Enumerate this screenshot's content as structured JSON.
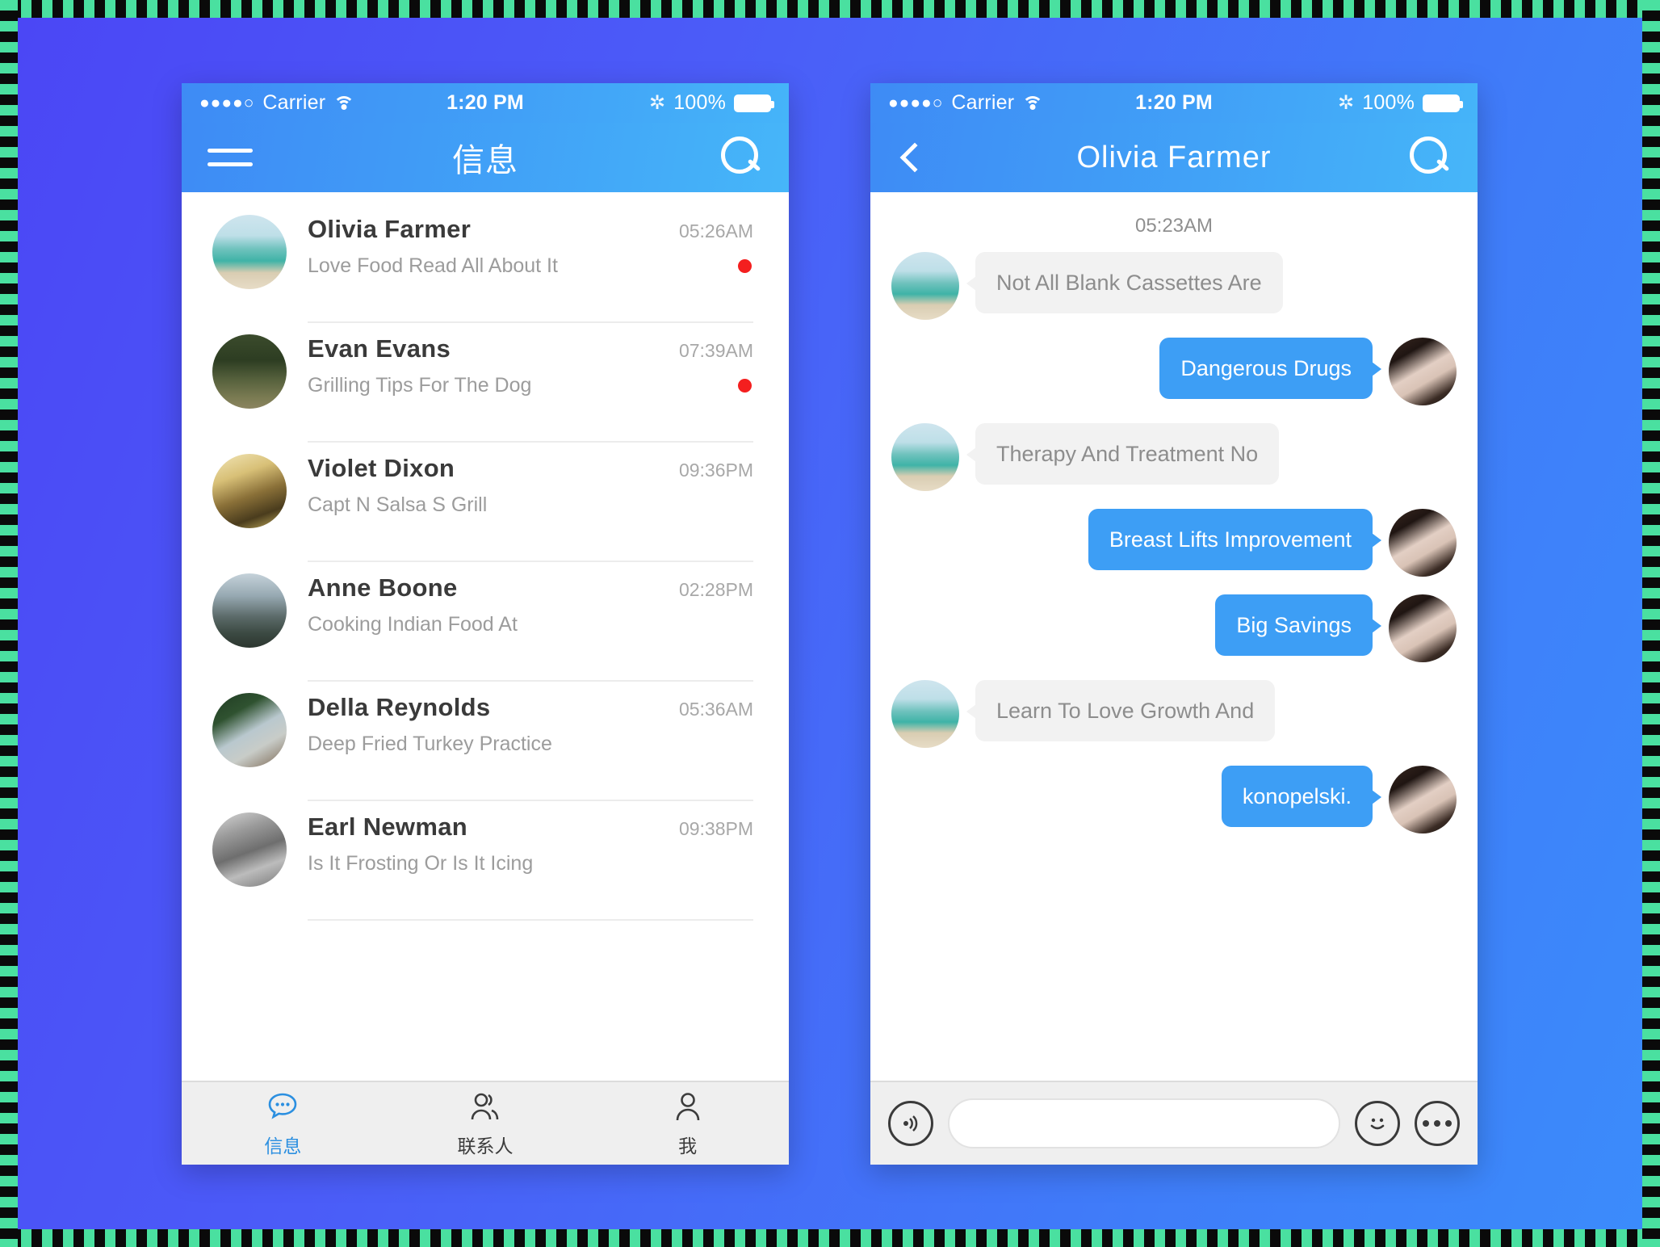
{
  "status_bar": {
    "signal_dots": "●●●●○",
    "carrier": "Carrier",
    "wifi_icon": "wifi-icon",
    "time": "1:20 PM",
    "bluetooth_icon": "bluetooth-icon",
    "bluetooth_glyph": "✲",
    "battery_percent": "100%",
    "battery_icon": "battery-icon"
  },
  "colors": {
    "nav_gradient_start": "#3e8bf5",
    "nav_gradient_end": "#46b6f9",
    "accent_blue": "#3d9ef5",
    "unread_red": "#f41f1f",
    "tab_active": "#2b8fe0",
    "page_background": "#4b4ff6"
  },
  "left_phone": {
    "nav": {
      "menu_icon": "hamburger-menu-icon",
      "title": "信息",
      "search_icon": "search-icon"
    },
    "conversations": [
      {
        "name": "Olivia Farmer",
        "preview": "Love Food Read All About It",
        "time": "05:26AM",
        "unread": true,
        "avatar": "av-beach"
      },
      {
        "name": "Evan Evans",
        "preview": "Grilling Tips For The Dog",
        "time": "07:39AM",
        "unread": true,
        "avatar": "av-forest"
      },
      {
        "name": "Violet Dixon",
        "preview": "Capt N Salsa S Grill",
        "time": "09:36PM",
        "unread": false,
        "avatar": "av-sunset"
      },
      {
        "name": "Anne Boone",
        "preview": "Cooking Indian Food At",
        "time": "02:28PM",
        "unread": false,
        "avatar": "av-mount"
      },
      {
        "name": "Della Reynolds",
        "preview": "Deep Fried Turkey Practice",
        "time": "05:36AM",
        "unread": false,
        "avatar": "av-xmas"
      },
      {
        "name": "Earl Newman",
        "preview": "Is It Frosting Or Is It Icing",
        "time": "09:38PM",
        "unread": false,
        "avatar": "av-mono"
      }
    ],
    "tabs": [
      {
        "label": "信息",
        "icon": "chat-bubble-icon",
        "active": true
      },
      {
        "label": "联系人",
        "icon": "contacts-icon",
        "active": false
      },
      {
        "label": "我",
        "icon": "person-icon",
        "active": false
      }
    ]
  },
  "right_phone": {
    "nav": {
      "back_icon": "back-chevron-icon",
      "title": "Olivia Farmer",
      "search_icon": "search-icon"
    },
    "chat": {
      "timestamp": "05:23AM",
      "messages": [
        {
          "side": "them",
          "text": "Not All Blank Cassettes Are",
          "avatar": "av-beach"
        },
        {
          "side": "me",
          "text": "Dangerous Drugs",
          "avatar": "av-child"
        },
        {
          "side": "them",
          "text": "Therapy And Treatment No",
          "avatar": "av-beach"
        },
        {
          "side": "me",
          "text": "Breast Lifts Improvement",
          "avatar": "av-child"
        },
        {
          "side": "me",
          "text": "Big Savings",
          "avatar": "av-child"
        },
        {
          "side": "them",
          "text": "Learn To Love Growth And",
          "avatar": "av-beach"
        },
        {
          "side": "me",
          "text": "konopelski.",
          "avatar": "av-child"
        }
      ]
    },
    "input_bar": {
      "voice_icon": "voice-record-icon",
      "input_value": "",
      "input_placeholder": "",
      "emoji_icon": "smiley-face-icon",
      "more_icon": "more-options-icon"
    }
  }
}
